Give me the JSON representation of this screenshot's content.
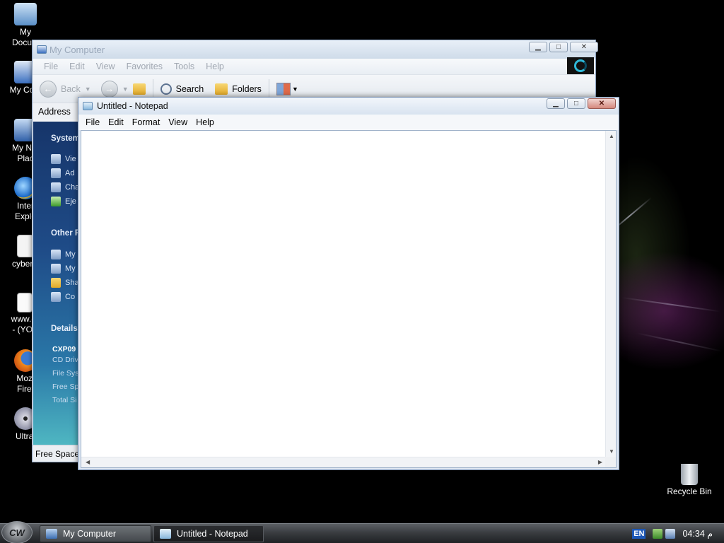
{
  "desktop": {
    "icons": [
      {
        "label": "My\nDocum",
        "icon": "my-documents-icon"
      },
      {
        "label": "My Com",
        "icon": "my-computer-icon"
      },
      {
        "label": "My Net\nPlac",
        "icon": "my-network-places-icon"
      },
      {
        "label": "Inter\nExplo",
        "icon": "internet-explorer-icon"
      },
      {
        "label": "cyberw",
        "icon": "text-document-icon"
      },
      {
        "label": "www.cy\n- (YOU",
        "icon": "shortcut-icon"
      },
      {
        "label": "Mozi\nFiref",
        "icon": "firefox-icon"
      },
      {
        "label": "Ultral",
        "icon": "ultraiso-disc-icon"
      }
    ],
    "recycle_bin": {
      "label": "Recycle Bin",
      "icon": "recycle-bin-icon"
    }
  },
  "my_computer": {
    "title": "My Computer",
    "menu": [
      "File",
      "Edit",
      "View",
      "Favorites",
      "Tools",
      "Help"
    ],
    "toolbar": {
      "back": "Back",
      "search": "Search",
      "folders": "Folders"
    },
    "address_label": "Address",
    "left_pane": {
      "system_tasks": {
        "heading": "System",
        "items": [
          "Vie",
          "Ad",
          "Cha",
          "Eje"
        ]
      },
      "other_places": {
        "heading": "Other P",
        "items": [
          "My",
          "My",
          "Sha",
          "Co"
        ]
      },
      "details": {
        "heading": "Details",
        "name": "CXP09",
        "type": "CD Driv",
        "lines": [
          "File Sys",
          "Free Sp",
          "Total Si"
        ]
      }
    },
    "status": "Free Space"
  },
  "notepad": {
    "title": "Untitled - Notepad",
    "menu": [
      "File",
      "Edit",
      "Format",
      "View",
      "Help"
    ],
    "content": ""
  },
  "taskbar": {
    "start_label": "CW",
    "tasks": [
      {
        "label": "My Computer",
        "active": false
      },
      {
        "label": "Untitled - Notepad",
        "active": true
      }
    ],
    "tray": {
      "language": "EN",
      "time": "04:34 م"
    }
  },
  "colors": {
    "left_pane_top": "#16356a",
    "left_pane_bottom": "#4fb7c2",
    "notepad_close": "#d4897d",
    "taskbar": "#3a3d41"
  }
}
